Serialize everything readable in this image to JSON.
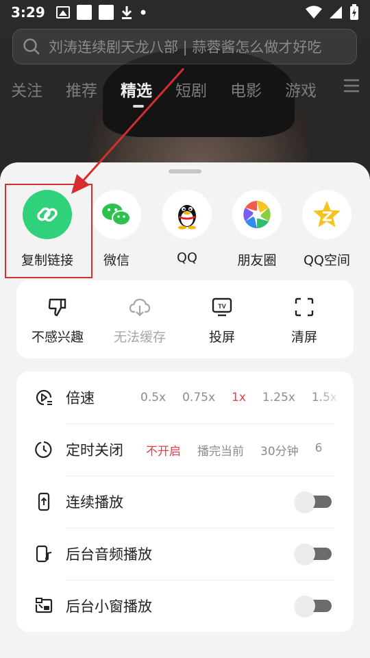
{
  "status_bar": {
    "time": "3:29"
  },
  "search": {
    "placeholder": "刘涛连续剧天龙八部 | 蒜蓉酱怎么做才好吃"
  },
  "tabs": [
    "关注",
    "推荐",
    "精选",
    "短剧",
    "电影",
    "游戏"
  ],
  "active_tab": "精选",
  "share": [
    {
      "label": "复制链接",
      "icon": "link-icon",
      "color": "#2fd27a"
    },
    {
      "label": "微信",
      "icon": "wechat-icon",
      "color": "#2dc14f"
    },
    {
      "label": "QQ",
      "icon": "qq-penguin-icon"
    },
    {
      "label": "朋友圈",
      "icon": "moments-icon"
    },
    {
      "label": "QQ空间",
      "icon": "qzone-star-icon",
      "color": "#f6c21c"
    }
  ],
  "actions": [
    {
      "label": "不感兴趣",
      "icon": "thumbs-down-icon",
      "disabled": false
    },
    {
      "label": "无法缓存",
      "icon": "cloud-download-icon",
      "disabled": true
    },
    {
      "label": "投屏",
      "icon": "tv-cast-icon",
      "disabled": false
    },
    {
      "label": "清屏",
      "icon": "fullscreen-corners-icon",
      "disabled": false
    }
  ],
  "settings": {
    "speed": {
      "label": "倍速",
      "options": [
        "0.5x",
        "0.75x",
        "1x",
        "1.25x",
        "1.5x"
      ],
      "selected": "1x"
    },
    "timer": {
      "label": "定时关闭",
      "options": [
        "不开启",
        "播完当前",
        "30分钟",
        "6"
      ],
      "selected": "不开启"
    },
    "continuous": {
      "label": "连续播放",
      "enabled": false
    },
    "background_audio": {
      "label": "后台音频播放",
      "enabled": false
    },
    "pip": {
      "label": "后台小窗播放",
      "enabled": false
    }
  },
  "accent_color": "#e63c4c",
  "annotation_color": "#d62e2e"
}
